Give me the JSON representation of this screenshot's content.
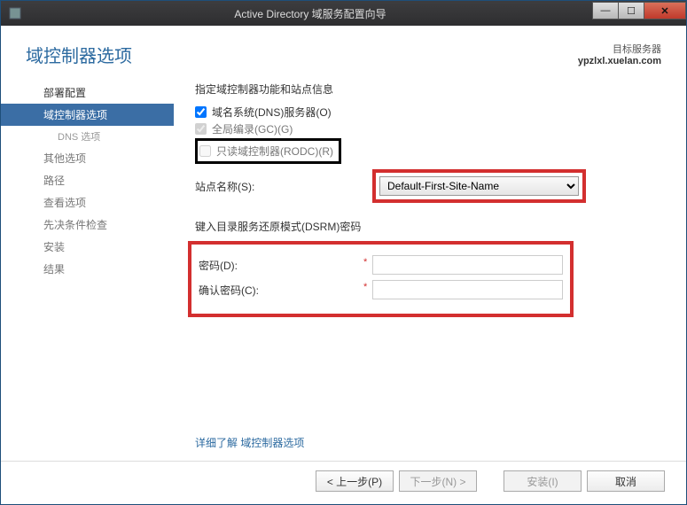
{
  "window": {
    "title": "Active Directory 域服务配置向导"
  },
  "header": {
    "page_title": "域控制器选项",
    "target_label": "目标服务器",
    "target_value": "ypzlxl.xuelan.com"
  },
  "sidebar": {
    "items": [
      {
        "label": "部署配置",
        "state": "completed"
      },
      {
        "label": "域控制器选项",
        "state": "active"
      },
      {
        "label": "DNS 选项",
        "state": "sub"
      },
      {
        "label": "其他选项",
        "state": ""
      },
      {
        "label": "路径",
        "state": ""
      },
      {
        "label": "查看选项",
        "state": ""
      },
      {
        "label": "先决条件检查",
        "state": ""
      },
      {
        "label": "安装",
        "state": ""
      },
      {
        "label": "结果",
        "state": ""
      }
    ]
  },
  "form": {
    "section1_label": "指定域控制器功能和站点信息",
    "dns_checkbox": "域名系统(DNS)服务器(O)",
    "gc_checkbox": "全局编录(GC)(G)",
    "rodc_checkbox": "只读域控制器(RODC)(R)",
    "site_label": "站点名称(S):",
    "site_value": "Default-First-Site-Name",
    "section2_label": "键入目录服务还原模式(DSRM)密码",
    "password_label": "密码(D):",
    "confirm_label": "确认密码(C):",
    "password_value": "",
    "confirm_value": ""
  },
  "more_link": {
    "prefix": "详细了解 ",
    "link_text": "域控制器选项"
  },
  "footer": {
    "prev": "< 上一步(P)",
    "next": "下一步(N) >",
    "install": "安装(I)",
    "cancel": "取消"
  }
}
